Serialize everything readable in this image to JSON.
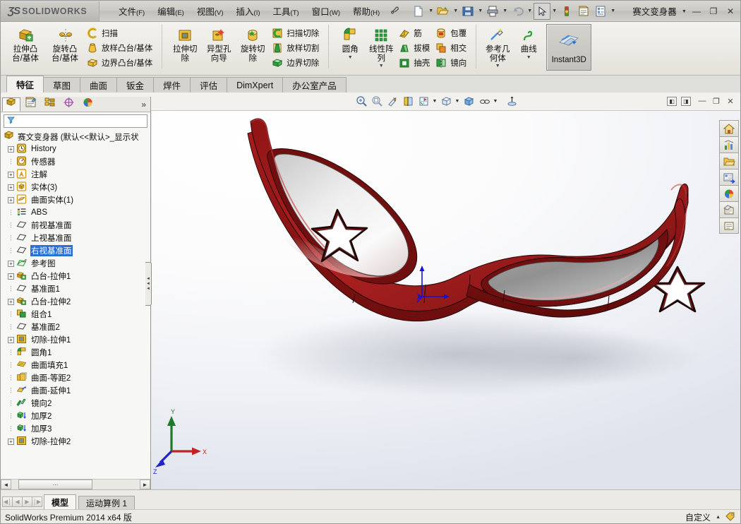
{
  "app": {
    "brand_ds": "ƷS",
    "brand_name": "SOLIDWORKS",
    "document_title": "赛文变身器",
    "status_text": "SolidWorks Premium 2014 x64 版",
    "customize_label": "自定义",
    "accent_color": "#2a6fd6",
    "model_color": "#9e1b1b"
  },
  "menubar": {
    "items": [
      {
        "label": "文件",
        "accel": "(F)",
        "name": "menu-file"
      },
      {
        "label": "编辑",
        "accel": "(E)",
        "name": "menu-edit"
      },
      {
        "label": "视图",
        "accel": "(V)",
        "name": "menu-view"
      },
      {
        "label": "插入",
        "accel": "(I)",
        "name": "menu-insert"
      },
      {
        "label": "工具",
        "accel": "(T)",
        "name": "menu-tools"
      },
      {
        "label": "窗口",
        "accel": "(W)",
        "name": "menu-window"
      },
      {
        "label": "帮助",
        "accel": "(H)",
        "name": "menu-help"
      }
    ],
    "pin_icon": "pin-icon"
  },
  "titlebar_tools": [
    {
      "name": "new-document-icon",
      "caret": true
    },
    {
      "name": "open-document-icon",
      "caret": true
    },
    {
      "name": "save-icon",
      "caret": true
    },
    {
      "name": "print-icon",
      "caret": true
    },
    {
      "name": "undo-icon",
      "caret": true
    },
    {
      "name": "select-icon",
      "caret": true,
      "selected": true
    },
    {
      "name": "rebuild-icon",
      "caret": false
    },
    {
      "name": "options-icon",
      "caret": false
    },
    {
      "name": "document-properties-icon",
      "caret": true
    }
  ],
  "window_buttons": {
    "help": "?",
    "minimize": "—",
    "restore": "❐",
    "close": "✕"
  },
  "ribbon": {
    "groups": [
      {
        "name": "boss-base-group",
        "big": [
          {
            "label": "拉伸凸\n台/基体",
            "name": "extruded-boss-base-button",
            "icon": "extrude-boss-icon",
            "caret": false
          },
          {
            "label": "旋转凸\n台/基体",
            "name": "revolved-boss-base-button",
            "icon": "revolve-boss-icon",
            "caret": false
          }
        ],
        "small": [
          {
            "label": "扫描",
            "name": "swept-boss-button",
            "icon": "sweep-icon"
          },
          {
            "label": "放样凸台/基体",
            "name": "lofted-boss-button",
            "icon": "loft-icon"
          },
          {
            "label": "边界凸台/基体",
            "name": "boundary-boss-button",
            "icon": "boundary-icon"
          }
        ]
      },
      {
        "name": "cut-group",
        "big": [
          {
            "label": "拉伸切\n除",
            "name": "extruded-cut-button",
            "icon": "extrude-cut-icon",
            "caret": false
          },
          {
            "label": "异型孔\n向导",
            "name": "hole-wizard-button",
            "icon": "hole-wizard-icon",
            "caret": false
          },
          {
            "label": "旋转切\n除",
            "name": "revolved-cut-button",
            "icon": "revolve-cut-icon",
            "caret": false
          }
        ],
        "small": [
          {
            "label": "扫描切除",
            "name": "swept-cut-button",
            "icon": "sweep-cut-icon"
          },
          {
            "label": "放样切割",
            "name": "lofted-cut-button",
            "icon": "loft-cut-icon"
          },
          {
            "label": "边界切除",
            "name": "boundary-cut-button",
            "icon": "boundary-cut-icon"
          }
        ]
      },
      {
        "name": "feature-group",
        "big": [
          {
            "label": "圆角",
            "name": "fillet-button",
            "icon": "fillet-icon",
            "caret": true
          },
          {
            "label": "线性阵\n列",
            "name": "linear-pattern-button",
            "icon": "linear-pattern-icon",
            "caret": true
          }
        ],
        "small": [
          {
            "label": "筋",
            "name": "rib-button",
            "icon": "rib-icon"
          },
          {
            "label": "拔模",
            "name": "draft-button",
            "icon": "draft-icon"
          },
          {
            "label": "抽壳",
            "name": "shell-button",
            "icon": "shell-icon"
          }
        ],
        "small2": [
          {
            "label": "包覆",
            "name": "wrap-button",
            "icon": "wrap-icon"
          },
          {
            "label": "相交",
            "name": "intersect-button",
            "icon": "intersect-icon"
          },
          {
            "label": "镜向",
            "name": "mirror-button",
            "icon": "mirror-icon"
          }
        ]
      },
      {
        "name": "reference-group",
        "big": [
          {
            "label": "参考几\n何体",
            "name": "reference-geometry-button",
            "icon": "reference-geometry-icon",
            "caret": true
          },
          {
            "label": "曲线",
            "name": "curves-button",
            "icon": "curve-icon",
            "caret": true
          }
        ]
      }
    ],
    "instant3d": {
      "label": "Instant3D",
      "name": "instant3d-button",
      "icon": "instant3d-icon",
      "active": true
    }
  },
  "command_tabs": [
    {
      "label": "特征",
      "name": "tab-features",
      "active": true
    },
    {
      "label": "草图",
      "name": "tab-sketch",
      "active": false
    },
    {
      "label": "曲面",
      "name": "tab-surfaces",
      "active": false
    },
    {
      "label": "钣金",
      "name": "tab-sheet-metal",
      "active": false
    },
    {
      "label": "焊件",
      "name": "tab-weldments",
      "active": false
    },
    {
      "label": "评估",
      "name": "tab-evaluate",
      "active": false
    },
    {
      "label": "DimXpert",
      "name": "tab-dimxpert",
      "active": false
    },
    {
      "label": "办公室产品",
      "name": "tab-office-products",
      "active": false
    }
  ],
  "view_toolbar": [
    {
      "name": "zoom-to-fit-icon",
      "caret": false
    },
    {
      "name": "zoom-to-area-icon",
      "caret": false
    },
    {
      "name": "previous-view-icon",
      "caret": false
    },
    {
      "name": "section-view-icon",
      "caret": false
    },
    {
      "name": "view-orientation-icon",
      "caret": true
    },
    {
      "name": "display-style-icon",
      "caret": true
    },
    {
      "name": "hide-show-items-icon",
      "caret": false
    },
    {
      "name": "appearance-icon",
      "caret": true
    },
    {
      "name": "apply-scene-icon",
      "caret": false
    }
  ],
  "mdi_buttons": [
    {
      "name": "restore-pane-left-icon"
    },
    {
      "name": "restore-pane-right-icon"
    },
    {
      "name": "minimize-window-icon",
      "glyph": "—"
    },
    {
      "name": "restore-window-icon",
      "glyph": "❐"
    },
    {
      "name": "close-window-icon",
      "glyph": "✕"
    }
  ],
  "feature_panel": {
    "tabs": [
      {
        "name": "tab-feature-manager",
        "icon": "feature-tree-icon",
        "active": true
      },
      {
        "name": "tab-property-manager",
        "icon": "property-manager-icon",
        "active": false
      },
      {
        "name": "tab-configuration-manager",
        "icon": "configuration-manager-icon",
        "active": false
      },
      {
        "name": "tab-dimxpert-manager",
        "icon": "dimxpert-manager-icon",
        "active": false
      },
      {
        "name": "tab-display-manager",
        "icon": "display-manager-icon",
        "active": false
      }
    ],
    "expand_chevron": "»",
    "filter": {
      "value": "",
      "placeholder": ""
    },
    "root": {
      "label": "赛文变身器  (默认<<默认>_显示状",
      "icon": "part-icon"
    },
    "items": [
      {
        "label": "History",
        "icon": "history-icon",
        "expandable": true,
        "selected": false
      },
      {
        "label": "传感器",
        "icon": "sensors-icon",
        "expandable": false,
        "selected": false
      },
      {
        "label": "注解",
        "icon": "annotations-icon",
        "expandable": true,
        "selected": false
      },
      {
        "label": "实体(3)",
        "icon": "solid-bodies-icon",
        "expandable": true,
        "selected": false
      },
      {
        "label": "曲面实体(1)",
        "icon": "surface-bodies-icon",
        "expandable": true,
        "selected": false
      },
      {
        "label": "ABS",
        "icon": "material-icon",
        "expandable": false,
        "selected": false
      },
      {
        "label": "前视基准面",
        "icon": "plane-icon",
        "expandable": false,
        "selected": false
      },
      {
        "label": "上视基准面",
        "icon": "plane-icon",
        "expandable": false,
        "selected": false
      },
      {
        "label": "右视基准面",
        "icon": "plane-icon",
        "expandable": false,
        "selected": true
      },
      {
        "label": "参考图",
        "icon": "sketch-icon",
        "expandable": true,
        "selected": false
      },
      {
        "label": "凸台-拉伸1",
        "icon": "extrude-boss-icon",
        "expandable": true,
        "selected": false
      },
      {
        "label": "基准面1",
        "icon": "plane-icon",
        "expandable": false,
        "selected": false
      },
      {
        "label": "凸台-拉伸2",
        "icon": "extrude-boss-icon",
        "expandable": true,
        "selected": false
      },
      {
        "label": "组合1",
        "icon": "combine-icon",
        "expandable": false,
        "selected": false
      },
      {
        "label": "基准面2",
        "icon": "plane-icon",
        "expandable": false,
        "selected": false
      },
      {
        "label": "切除-拉伸1",
        "icon": "extrude-cut-icon",
        "expandable": true,
        "selected": false
      },
      {
        "label": "圆角1",
        "icon": "fillet-icon",
        "expandable": false,
        "selected": false
      },
      {
        "label": "曲面填充1",
        "icon": "surface-fill-icon",
        "expandable": false,
        "selected": false
      },
      {
        "label": "曲面-等距2",
        "icon": "surface-offset-icon",
        "expandable": false,
        "selected": false
      },
      {
        "label": "曲面-延伸1",
        "icon": "surface-extend-icon",
        "expandable": false,
        "selected": false
      },
      {
        "label": "镜向2",
        "icon": "mirror-icon",
        "expandable": false,
        "selected": false
      },
      {
        "label": "加厚2",
        "icon": "thicken-icon",
        "expandable": false,
        "selected": false
      },
      {
        "label": "加厚3",
        "icon": "thicken-icon",
        "expandable": false,
        "selected": false
      },
      {
        "label": "切除-拉伸2",
        "icon": "extrude-cut-icon",
        "expandable": true,
        "selected": false
      }
    ],
    "hscroll": {
      "thumb_glyph": "⋯",
      "left_arrow": "◄",
      "right_arrow": "►"
    }
  },
  "graphics": {
    "triad": {
      "x_label": "X",
      "y_label": "Y",
      "z_label": "Z",
      "x_color": "#c32222",
      "y_color": "#1e7a2a",
      "z_color": "#2222c8"
    },
    "origin_color": "#1414d2",
    "model_name": "赛文变身器-mask-model"
  },
  "right_toolbar": [
    {
      "name": "view-home-icon"
    },
    {
      "name": "solidworks-resources-icon"
    },
    {
      "name": "design-library-icon"
    },
    {
      "name": "file-explorer-icon"
    },
    {
      "name": "view-palette-icon"
    },
    {
      "name": "appearances-scenes-icon"
    },
    {
      "name": "custom-properties-icon"
    }
  ],
  "document_tabs": {
    "nav": [
      {
        "name": "first-tab-button",
        "glyph": "◀│",
        "enabled": false
      },
      {
        "name": "prev-tab-button",
        "glyph": "◀",
        "enabled": false
      },
      {
        "name": "next-tab-button",
        "glyph": "▶",
        "enabled": false
      },
      {
        "name": "last-tab-button",
        "glyph": "│▶",
        "enabled": false
      }
    ],
    "tabs": [
      {
        "label": "模型",
        "name": "doc-tab-model",
        "active": true
      },
      {
        "label": "运动算例 1",
        "name": "doc-tab-motion-study-1",
        "active": false
      }
    ]
  }
}
